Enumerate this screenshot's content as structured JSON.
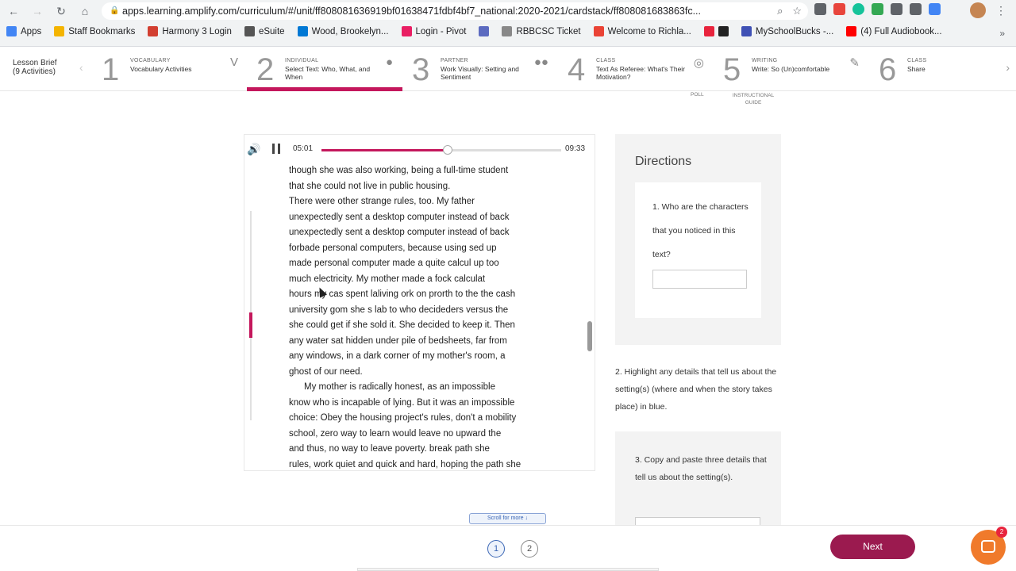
{
  "browser": {
    "url": "apps.learning.amplify.com/curriculum/#/unit/ff808081636919bf01638471fdbf4bf7_national:2020-2021/cardstack/ff808081683863fc...",
    "bookmarks": [
      "Apps",
      "Staff Bookmarks",
      "Harmony 3 Login",
      "eSuite",
      "Wood, Brookelyn...",
      "Login - Pivot",
      "RBBCSC Ticket",
      "Welcome to Richla...",
      "MySchoolBucks -...",
      "(4) Full Audiobook..."
    ],
    "bookmark_colors": [
      "#4285f4",
      "#f4b400",
      "#d23f31",
      "#555555",
      "#0078d4",
      "#e91e63",
      "#5c6bc0",
      "#888888",
      "#ea4335",
      "#222222",
      "#3f51b5",
      "#ff0000"
    ],
    "extensions_badge": "3",
    "more_label": "»"
  },
  "lesson": {
    "title": "Lesson Brief",
    "count": "(9 Activities)"
  },
  "steps": [
    {
      "num": "1",
      "kind": "Vocabulary",
      "title": "Vocabulary Activities",
      "icon": "V"
    },
    {
      "num": "2",
      "kind": "Individual",
      "title": "Select Text: Who, What, and When",
      "icon": "person-icon"
    },
    {
      "num": "3",
      "kind": "Partner",
      "title": "Work Visually: Setting and Sentiment",
      "icon": "partner-icon"
    },
    {
      "num": "4",
      "kind": "Class",
      "title": "Text As Referee: What's Their Motivation?",
      "icon": "bulb-icon"
    },
    {
      "num": "5",
      "kind": "Writing",
      "title": "Write: So (Un)comfortable",
      "icon": "pencil-icon"
    },
    {
      "num": "6",
      "kind": "Class",
      "title": "Share",
      "icon": ""
    }
  ],
  "tools": {
    "poll": "Poll",
    "guide": "Instructional Guide"
  },
  "audio": {
    "current": "05:01",
    "total": "09:33",
    "progress": 0.525
  },
  "reading": [
    "though she was also working, being a full-time student",
    "that she could not live in public housing.",
    "There were other strange rules, too. My father",
    "unexpectedly sent a desktop computer instead of back",
    "unexpectedly sent a desktop computer instead of back",
    "forbade personal computers, because using sed up",
    "made personal computer made a quite calcul up too",
    "much electricity. My mother made a fock calculat",
    "hours my cas spent laliving ork on prorth to the the cash",
    "university gom she s lab to who decideders versus the",
    "she could get if she sold it. She decided to keep it. Then",
    "any water sat hidden under pile of bedsheets, far from",
    "any windows, in a dark corner of my mother's room, a",
    "ghost of our need.",
    "My mother is radically honest, as an impossible",
    "know who is incapable of lying. But it was an impossible",
    "choice: Obey the housing project's rules, don't a mobility",
    "school, zero way to learn would leave no upward the",
    "and thus, no way to leave poverty. break path she",
    "rules, work quiet and quick and hard, hoping the path she"
  ],
  "directions": {
    "title": "Directions",
    "q1": "1. Who are the characters that you noticed in this text?",
    "q1_value": "",
    "q2": "2. Highlight any details that tell us about the setting(s) (where and when the story takes place) in blue.",
    "q3": "3. Copy and paste three details that tell us about the setting(s)."
  },
  "scroll_more": "Scroll for more ↓",
  "pages": [
    "1",
    "2"
  ],
  "next_label": "Next",
  "chat_badge": "2",
  "colors": {
    "accent": "#c4175c",
    "next": "#9b1a4f",
    "chat": "#f07a2b"
  }
}
